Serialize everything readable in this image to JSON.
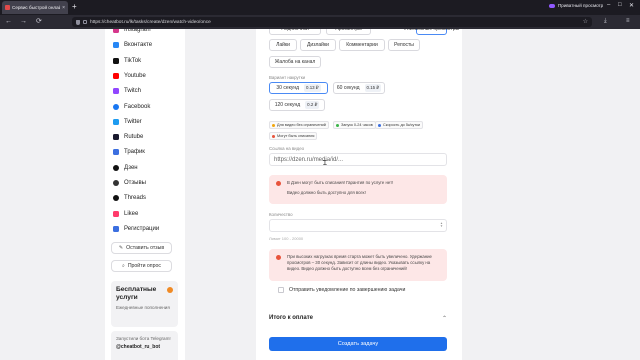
{
  "browser": {
    "tab_title": "Сервис быстрой онлайн-накр",
    "tab_close": "×",
    "new_tab": "+",
    "private_label": "Приватный просмотр",
    "url": "https://cheatbot.ru/lk/tasks/create/dzen/watch-video/once",
    "controls": {
      "back": "←",
      "forward": "→",
      "reload": "⟳",
      "minimize": "–",
      "maximize": "□",
      "close": "✕",
      "star": "☆",
      "download": "⤓",
      "menu": "≡"
    }
  },
  "sidebar": {
    "items": [
      {
        "label": "Instagram",
        "color": "#d6378c",
        "round": false
      },
      {
        "label": "Вконтакте",
        "color": "#2787f5",
        "round": false
      },
      {
        "label": "TikTok",
        "color": "#111111",
        "round": false
      },
      {
        "label": "Youtube",
        "color": "#ff0000",
        "round": false
      },
      {
        "label": "Twitch",
        "color": "#9146ff",
        "round": false
      },
      {
        "label": "Facebook",
        "color": "#1877f2",
        "round": true
      },
      {
        "label": "Twitter",
        "color": "#1d9bf0",
        "round": false
      },
      {
        "label": "Rutube",
        "color": "#1a1a2e",
        "round": false
      },
      {
        "label": "Трафик",
        "color": "#3b6fe0",
        "round": false
      },
      {
        "label": "Дзен",
        "color": "#111111",
        "round": true
      },
      {
        "label": "Отзывы",
        "color": "#333333",
        "round": true
      },
      {
        "label": "Threads",
        "color": "#111111",
        "round": true
      },
      {
        "label": "Likee",
        "color": "#ff3b6b",
        "round": false
      },
      {
        "label": "Регистрации",
        "color": "#3b6fe0",
        "round": false
      }
    ],
    "leave_review": "Оставить отзыв",
    "take_survey": "Пройти опрос",
    "promo_title": "Бесплатные услуги",
    "promo_sub": "Ежедневные пополнения",
    "promo2_text": "Запустили бота Telegram!",
    "promo2_bot": "@cheatbot_ru_bot"
  },
  "main": {
    "type_row1": [
      "Подписчики",
      "Просмотры",
      "Уникальные просмотры"
    ],
    "type_row2": [
      "Лайки",
      "Дизлайки",
      "Комментарии",
      "Репосты"
    ],
    "type_row3": [
      "Жалоба на канал"
    ],
    "duration_label": "Вариант накрутки",
    "durations": [
      {
        "label": "30 секунд",
        "price": "0.13 ₽",
        "selected": true
      },
      {
        "label": "60 секунд",
        "price": "0.15 ₽",
        "selected": false
      },
      {
        "label": "120 секунд",
        "price": "0.2 ₽",
        "selected": false
      }
    ],
    "tags": [
      {
        "label": "Для видео без ограничений",
        "color": "#f2a60c"
      },
      {
        "label": "Запуск 0-24 часов",
        "color": "#3bb54a"
      },
      {
        "label": "Скорость до 5к/сутки",
        "color": "#3b6fe0"
      },
      {
        "label": "Могут быть списания",
        "color": "#e8543c"
      }
    ],
    "link_label": "Ссылка на видео",
    "link_placeholder": "https://dzen.ru/media/id/...",
    "alert1_line1": "В Дзен могут быть списания! Гарантия по услуге нет!",
    "alert1_line2": "Видео должно быть доступно для всех!",
    "qty_label": "Количество",
    "qty_hint": "Лимит 100 - 20000",
    "alert2_text": "При высоких нагрузках время старта может быть увеличено. Удержание просмотров – 30 секунд. Зависит от длины видео. Указывать ссылку на видео. Видео должно быть доступно всем без ограничений!",
    "notify_label": "Отправить уведомление по завершению задачи",
    "total_label": "Итого к оплате",
    "total_chevron": "⌃",
    "submit_label": "Создать задачу"
  }
}
